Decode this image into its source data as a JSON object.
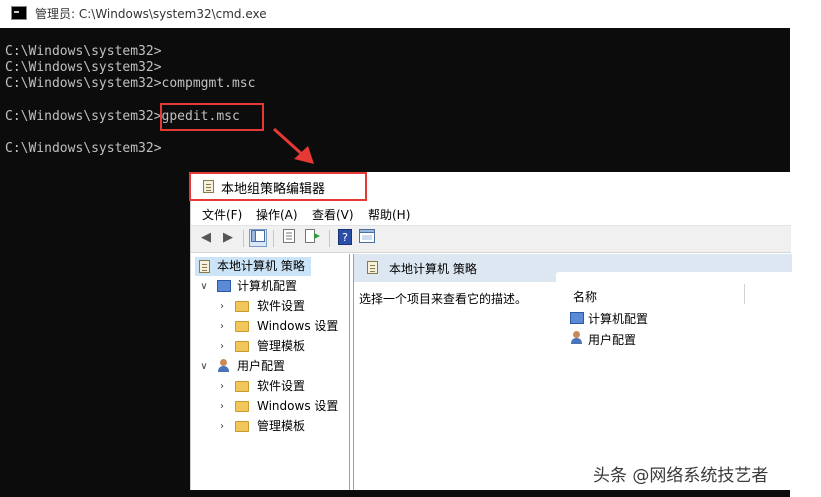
{
  "cmd": {
    "title": "管理员: C:\\Windows\\system32\\cmd.exe",
    "lines": [
      "C:\\Windows\\system32>",
      "C:\\Windows\\system32>",
      "C:\\Windows\\system32>compmgmt.msc",
      "",
      "C:\\Windows\\system32>gpedit.msc",
      "",
      "C:\\Windows\\system32>"
    ]
  },
  "gp": {
    "title": "本地组策略编辑器",
    "menu": [
      "文件(F)",
      "操作(A)",
      "查看(V)",
      "帮助(H)"
    ],
    "tree": {
      "root": "本地计算机 策略",
      "computer": "计算机配置",
      "computer_children": [
        "软件设置",
        "Windows 设置",
        "管理模板"
      ],
      "user": "用户配置",
      "user_children": [
        "软件设置",
        "Windows 设置",
        "管理模板"
      ]
    },
    "right": {
      "header": "本地计算机 策略",
      "description": "选择一个项目来查看它的描述。",
      "column_name": "名称",
      "items": [
        "计算机配置",
        "用户配置"
      ]
    }
  },
  "colors": {
    "highlight": "#e53935",
    "console_bg": "#0c0c0c",
    "console_text": "#c0c0c0"
  },
  "watermark": "头条 @网络系统技艺者"
}
